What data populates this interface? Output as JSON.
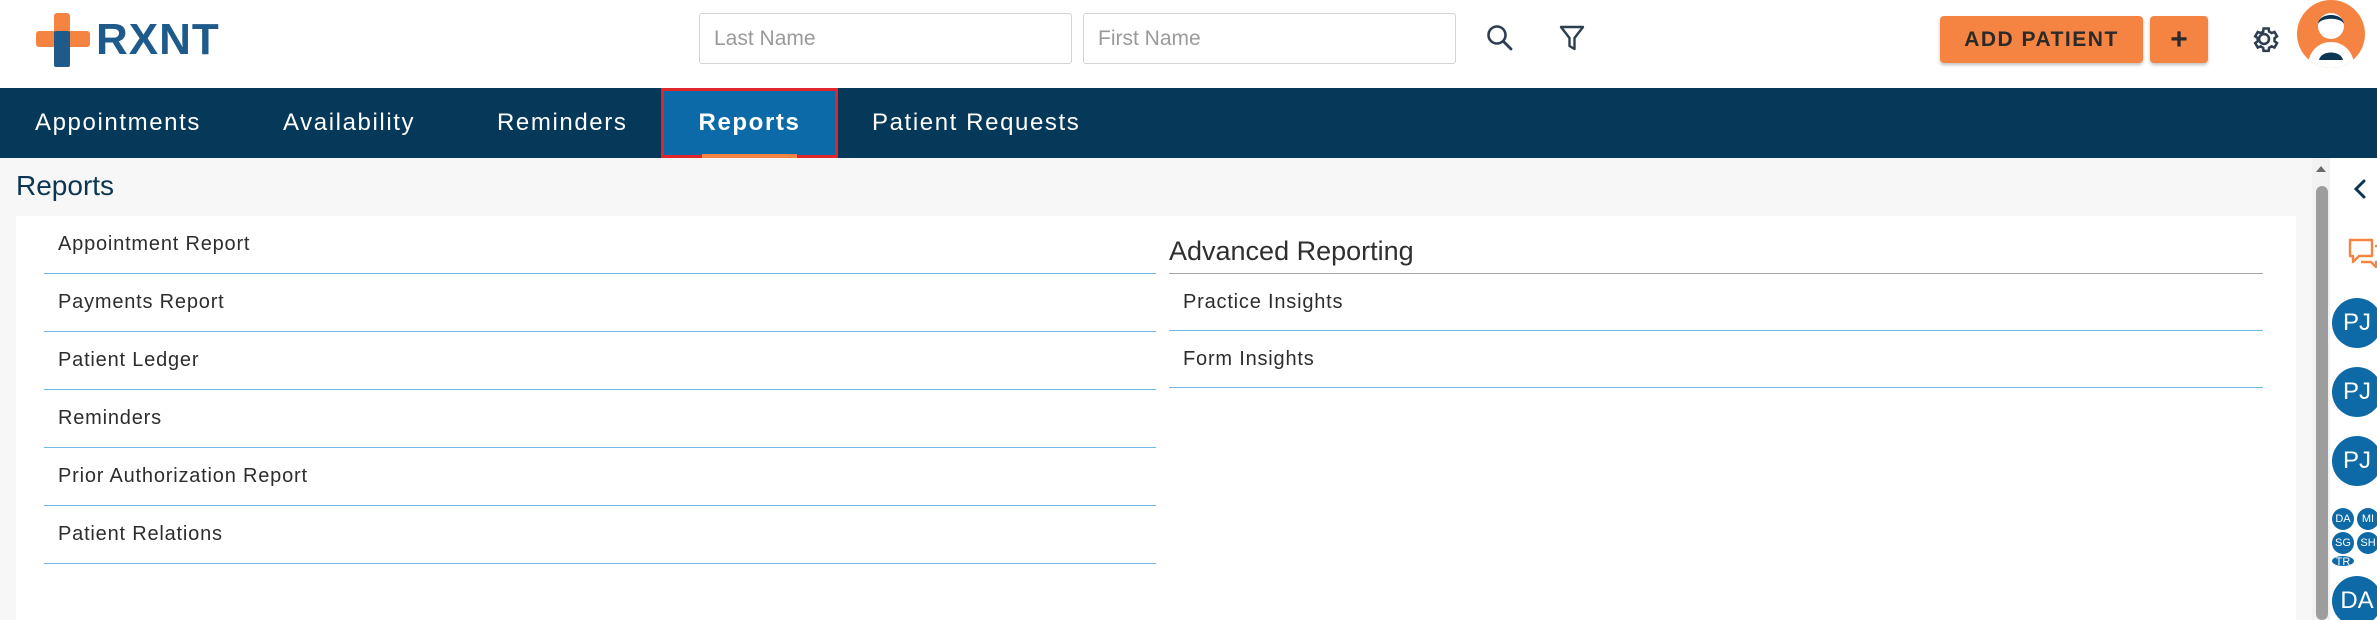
{
  "header": {
    "brand_name": "RXNT",
    "last_name_placeholder": "Last Name",
    "first_name_placeholder": "First Name",
    "add_patient_label": "ADD PATIENT",
    "add_plus_label": "+",
    "accent_color": "#f58442",
    "brand_color": "#1e5a8a"
  },
  "nav": {
    "items": [
      {
        "label": "Appointments"
      },
      {
        "label": "Availability"
      },
      {
        "label": "Reminders"
      },
      {
        "label": "Reports",
        "active": true
      },
      {
        "label": "Patient Requests"
      }
    ],
    "background_color": "#06385a",
    "active_color": "#0d6aa8"
  },
  "main": {
    "title": "Reports",
    "reports": [
      {
        "label": "Appointment Report"
      },
      {
        "label": "Payments Report"
      },
      {
        "label": "Patient Ledger"
      },
      {
        "label": "Reminders"
      },
      {
        "label": "Prior Authorization Report"
      },
      {
        "label": "Patient Relations"
      }
    ],
    "advanced": {
      "title": "Advanced Reporting",
      "items": [
        {
          "label": "Practice Insights"
        },
        {
          "label": "Form Insights"
        }
      ]
    }
  },
  "rail": {
    "avatars": [
      "PJ",
      "PJ",
      "PJ"
    ],
    "mini_avatars": [
      "DA",
      "MI",
      "SG",
      "SH",
      "TR"
    ],
    "last_avatar": "DA"
  },
  "icons": {
    "search": "search-icon",
    "filter": "filter-icon",
    "settings": "gear-icon",
    "chat": "chat-icon",
    "collapse": "chevron-left-icon",
    "user": "user-avatar-icon"
  }
}
